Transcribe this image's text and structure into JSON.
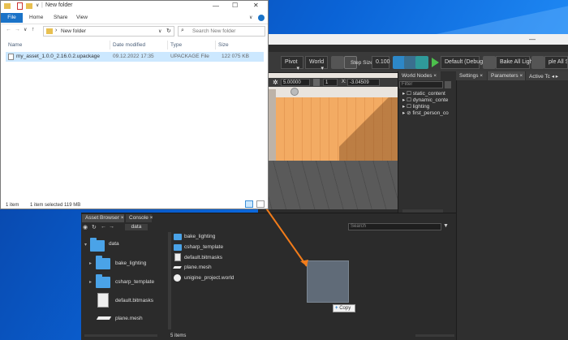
{
  "explorer": {
    "title": "New folder",
    "ribbon": {
      "file": "File",
      "home": "Home",
      "share": "Share",
      "view": "View"
    },
    "address": "New folder",
    "search_placeholder": "Search New folder",
    "columns": {
      "name": "Name",
      "date": "Date modified",
      "type": "Type",
      "size": "Size"
    },
    "file": {
      "name": "my_asset_1.0.0_2.16.0.2.upackage",
      "date": "09.12.2022 17:35",
      "type": "UPACKAGE File",
      "size": "122 075 KB"
    },
    "status": {
      "count": "1 item",
      "selected": "1 item selected  119 MB"
    },
    "title_icons": {
      "down": "∨",
      "pipe": "|"
    },
    "window_buttons": {
      "minimize": "—",
      "maximize": "☐",
      "close": "✕"
    },
    "nav": {
      "back": "←",
      "forward": "→",
      "down": "∨",
      "up": "↑",
      "refresh": "↻",
      "sep": "›",
      "search_icon": "⌕"
    }
  },
  "editor": {
    "toolbar": {
      "pivot": "Pivot",
      "world": "World",
      "step_size_label": "Step Size",
      "step_size_value": "0.100",
      "play": "Default (Debug)",
      "bake": "Bake All Lighting",
      "bake_shadows": "ple All Sh"
    },
    "viewport_fields": {
      "f1": "5.00000",
      "f2": "1",
      "x_label": "X:",
      "x_value": "-3.04509"
    },
    "world_nodes": {
      "title": "World Nodes",
      "filter_placeholder": "Filter",
      "nodes": [
        "static_content",
        "dynamic_conte",
        "lighting",
        "first_person_co"
      ]
    },
    "right_tabs": [
      "Settings",
      "Parameters",
      "Active Tc"
    ],
    "asset_browser": {
      "tabs": [
        "Asset Browser",
        "Console"
      ],
      "breadcrumb": "data",
      "search_placeholder": "Search",
      "tree_root": "data",
      "tree": [
        "bake_lighting",
        "csharp_template",
        "default.bitmasks",
        "plane.mesh"
      ],
      "files": [
        "bake_lighting",
        "csharp_template",
        "default.bitmasks",
        "plane.mesh",
        "unigine_project.world"
      ],
      "status": "5 items"
    },
    "drag_tooltip": "Copy"
  }
}
